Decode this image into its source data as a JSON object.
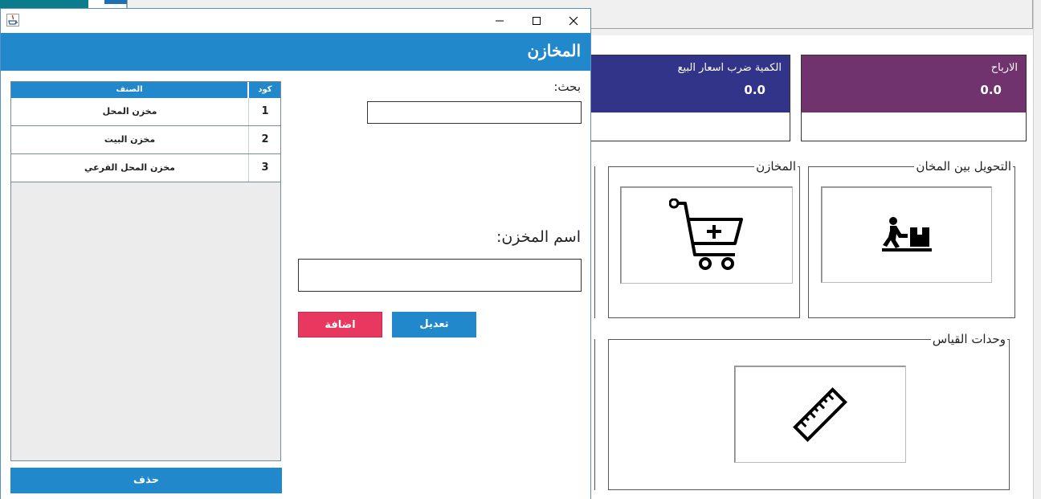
{
  "background": {
    "cards": [
      {
        "title": "الارباح",
        "value": "0.0",
        "color": "#70336e"
      },
      {
        "title": "الكمية ضرب اسعار البيع",
        "value": "0.0",
        "color": "#32348a"
      }
    ],
    "groups": {
      "transfer": {
        "label": "التحويل بين المخان",
        "icon": "worker-pushing-box-icon"
      },
      "stores": {
        "label": "المخازن",
        "icon": "cart-add-icon"
      },
      "units": {
        "label": "وحدات القياس",
        "icon": "ruler-icon"
      }
    }
  },
  "dialog": {
    "app_icon": "java-cup-icon",
    "header_title": "المخازن",
    "table": {
      "columns": {
        "code": "كود",
        "name": "الصنف"
      },
      "rows": [
        {
          "code": "1",
          "name": "مخزن المحل"
        },
        {
          "code": "2",
          "name": "مخزن البيت"
        },
        {
          "code": "3",
          "name": "مخزن المحل الفرعي"
        }
      ]
    },
    "delete_label": "حذف",
    "search_label": "بحث:",
    "search_value": "",
    "store_name_label": "اسم المخزن:",
    "store_name_value": "",
    "edit_label": "تعديل",
    "add_label": "اضافة",
    "colors": {
      "header": "#2288cc",
      "add": "#e8385f"
    }
  }
}
